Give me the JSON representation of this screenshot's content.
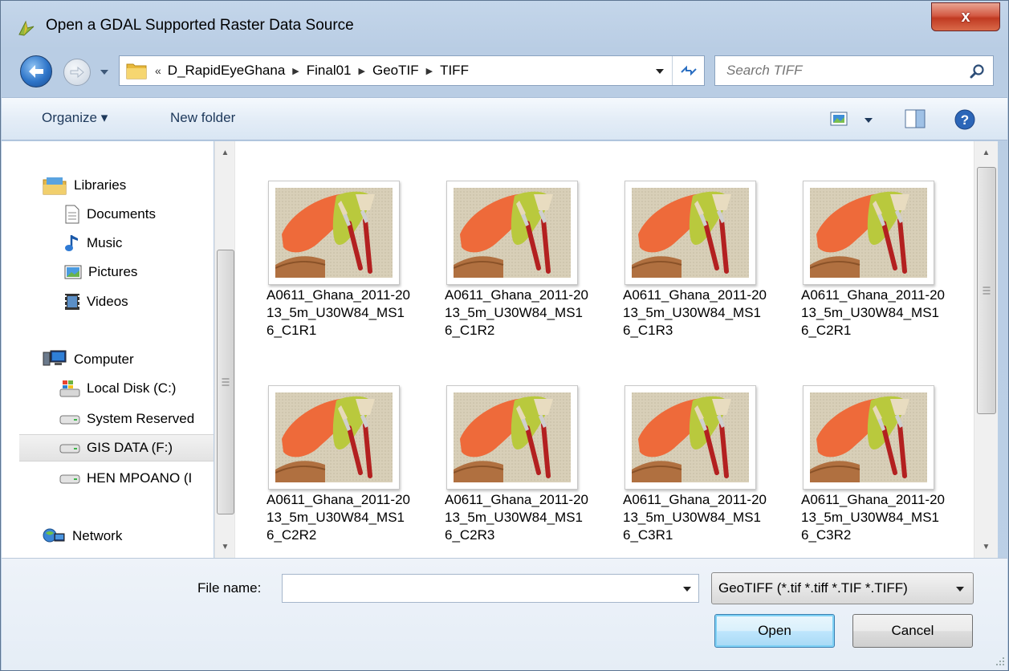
{
  "window": {
    "title": "Open a GDAL Supported Raster Data Source",
    "close_glyph": "x"
  },
  "address": {
    "chevron": "«",
    "crumbs": [
      "D_RapidEyeGhana",
      "Final01",
      "GeoTIF",
      "TIFF"
    ],
    "separator": "▶"
  },
  "search": {
    "placeholder": "Search TIFF"
  },
  "commandbar": {
    "organize_label": "Organize ▾",
    "new_folder_label": "New folder"
  },
  "nav": {
    "libraries": "Libraries",
    "documents": "Documents",
    "music": "Music",
    "pictures": "Pictures",
    "videos": "Videos",
    "computer": "Computer",
    "local_disk": "Local Disk (C:)",
    "system_reserved": "System Reserved",
    "gis_data": "GIS DATA (F:)",
    "hen_mpoano": "HEN MPOANO (I",
    "network": "Network"
  },
  "files": [
    {
      "label": "A0611_Ghana_2011-2013_5m_U30W84_MS16_C1R1"
    },
    {
      "label": "A0611_Ghana_2011-2013_5m_U30W84_MS16_C1R2"
    },
    {
      "label": "A0611_Ghana_2011-2013_5m_U30W84_MS16_C1R3"
    },
    {
      "label": "A0611_Ghana_2011-2013_5m_U30W84_MS16_C2R1"
    },
    {
      "label": "A0611_Ghana_2011-2013_5m_U30W84_MS16_C2R2"
    },
    {
      "label": "A0611_Ghana_2011-2013_5m_U30W84_MS16_C2R3"
    },
    {
      "label": "A0611_Ghana_2011-2013_5m_U30W84_MS16_C3R1"
    },
    {
      "label": "A0611_Ghana_2011-2013_5m_U30W84_MS16_C3R2"
    }
  ],
  "bottom": {
    "file_name_label": "File name:",
    "file_name_value": "",
    "filter_value": "GeoTIFF (*.tif *.tiff *.TIF *.TIFF)",
    "open_label": "Open",
    "cancel_label": "Cancel"
  },
  "colors": {
    "chrome": "#bcd0e6",
    "close_red": "#c03a22",
    "link_blue": "#1e395b",
    "selected_bg": "#e3e3e3"
  }
}
